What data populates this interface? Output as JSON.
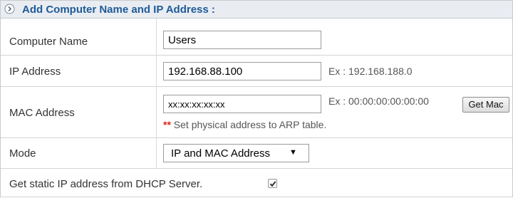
{
  "header": {
    "icon": "chevron-right-circle-icon",
    "title": "Add Computer Name and IP Address :"
  },
  "computer_name": {
    "label": "Computer Name",
    "value": "Users"
  },
  "ip_address": {
    "label": "IP Address",
    "value": "192.168.88.100",
    "example": "Ex : 192.168.188.0"
  },
  "mac_address": {
    "label": "MAC Address",
    "value": "xx:xx:xx:xx:xx",
    "example": "Ex : 00:00:00:00:00:00",
    "get_mac_label": "Get Mac",
    "note_marker": "**",
    "note_text": " Set physical address to ARP table."
  },
  "mode": {
    "label": "Mode",
    "selected": "IP and MAC Address",
    "arrow_icon": "caret-down-icon"
  },
  "dhcp": {
    "label": "Get static IP address from DHCP Server.",
    "checked": true,
    "check_icon": "checkmark-icon"
  },
  "colors": {
    "header_title": "#1f5a97",
    "header_background": "#e9edf2",
    "note_marker": "#e0241b"
  }
}
